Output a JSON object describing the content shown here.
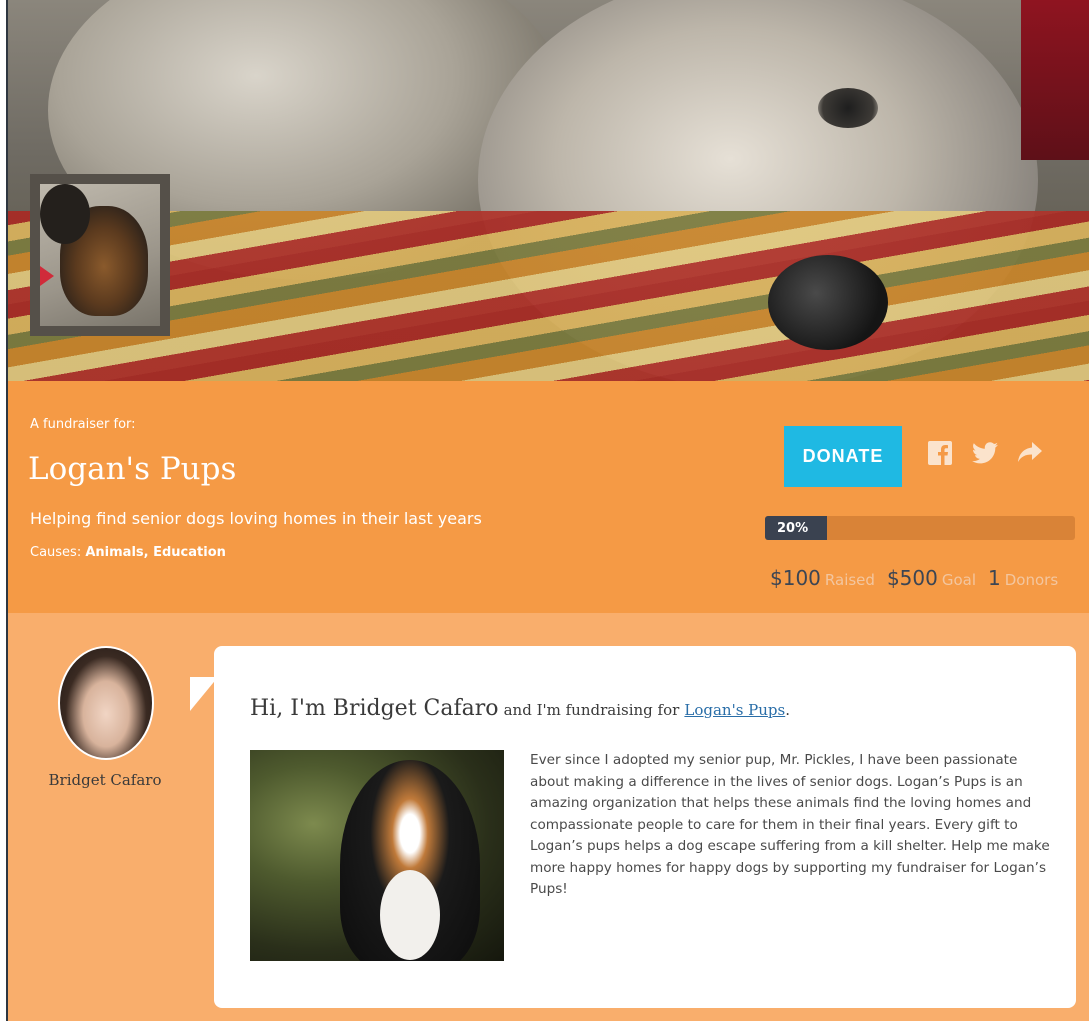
{
  "header": {
    "for_label": "A fundraiser for:",
    "org_name": "Logan's Pups",
    "tagline": "Helping find senior dogs loving homes in their last years",
    "causes_label": "Causes:",
    "causes_value": "Animals, Education",
    "donate_label": "DONATE",
    "share_icons": [
      "facebook-icon",
      "twitter-icon",
      "share-arrow-icon"
    ]
  },
  "progress": {
    "percent": 20,
    "percent_label": "20%"
  },
  "stats": {
    "raised_value": "$100",
    "raised_label": "Raised",
    "goal_value": "$500",
    "goal_label": "Goal",
    "donors_value": "1",
    "donors_label": "Donors"
  },
  "profile": {
    "name": "Bridget Cafaro"
  },
  "story": {
    "greeting": "Hi, I'm Bridget Cafaro",
    "connector": "and I'm fundraising for",
    "org_link": "Logan's Pups",
    "period": ".",
    "body": "Ever since I adopted my senior pup, Mr. Pickles, I have been passionate about making a difference in the lives of senior dogs. Logan’s Pups is an amazing organization that helps these animals find the loving homes and compassionate people to care for them in their final years. Every gift to Logan’s pups helps a dog escape suffering from a kill shelter. Help me make more happy homes for happy dogs by supporting my fundraiser for Logan’s Pups!"
  },
  "colors": {
    "header_orange": "#f59a45",
    "content_orange": "#f9ae6c",
    "donate_blue": "#1fb9e3",
    "progress_dark": "#3a4250",
    "link_blue": "#2a6ea8"
  }
}
